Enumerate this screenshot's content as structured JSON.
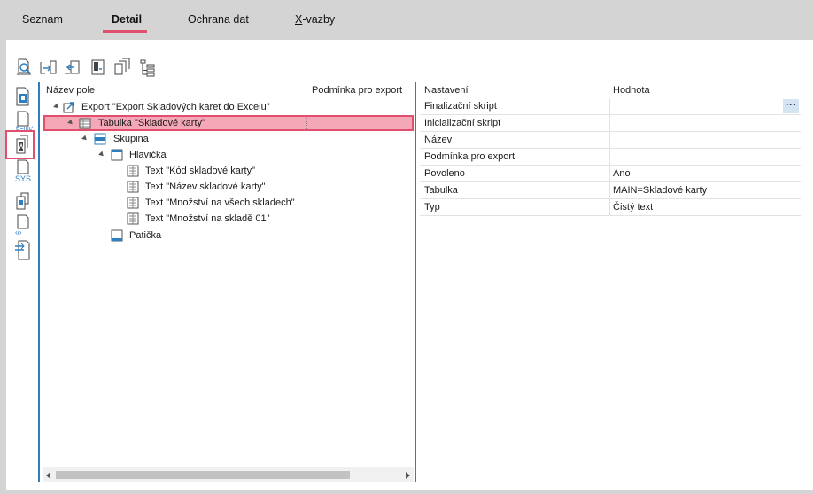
{
  "tabs": [
    {
      "label": "Seznam"
    },
    {
      "label": "Detail",
      "active": true
    },
    {
      "label": "Ochrana dat"
    },
    {
      "label_prefix": "X",
      "label_rest": "-vazby"
    }
  ],
  "tree": {
    "col1": "Název pole",
    "col2": "Podmínka pro export",
    "nodes": [
      {
        "label": "Export \"Export Skladových karet do Excelu\""
      },
      {
        "label": "Tabulka \"Skladové karty\"",
        "selected": true
      },
      {
        "label": "Skupina"
      },
      {
        "label": "Hlavička"
      },
      {
        "label": "Text \"Kód skladové karty\""
      },
      {
        "label": "Text \"Název skladové karty\""
      },
      {
        "label": "Text \"Množství na všech skladech\""
      },
      {
        "label": "Text \"Množství na skladě 01\""
      },
      {
        "label": "Patička"
      }
    ]
  },
  "props": {
    "col1": "Nastavení",
    "col2": "Hodnota",
    "ellipsis": "···",
    "rows": [
      {
        "name": "Finalizační skript",
        "value": ""
      },
      {
        "name": "Inicializační skript",
        "value": ""
      },
      {
        "name": "Název",
        "value": ""
      },
      {
        "name": "Podmínka pro export",
        "value": ""
      },
      {
        "name": "Povoleno",
        "value": "Ano"
      },
      {
        "name": "Tabulka",
        "value": "MAIN=Skladové karty"
      },
      {
        "name": "Typ",
        "value": "Čistý text"
      }
    ]
  },
  "colors": {
    "accent": "#e0506c",
    "selection": "#f4a7b7",
    "divider": "#2d7fc1"
  }
}
